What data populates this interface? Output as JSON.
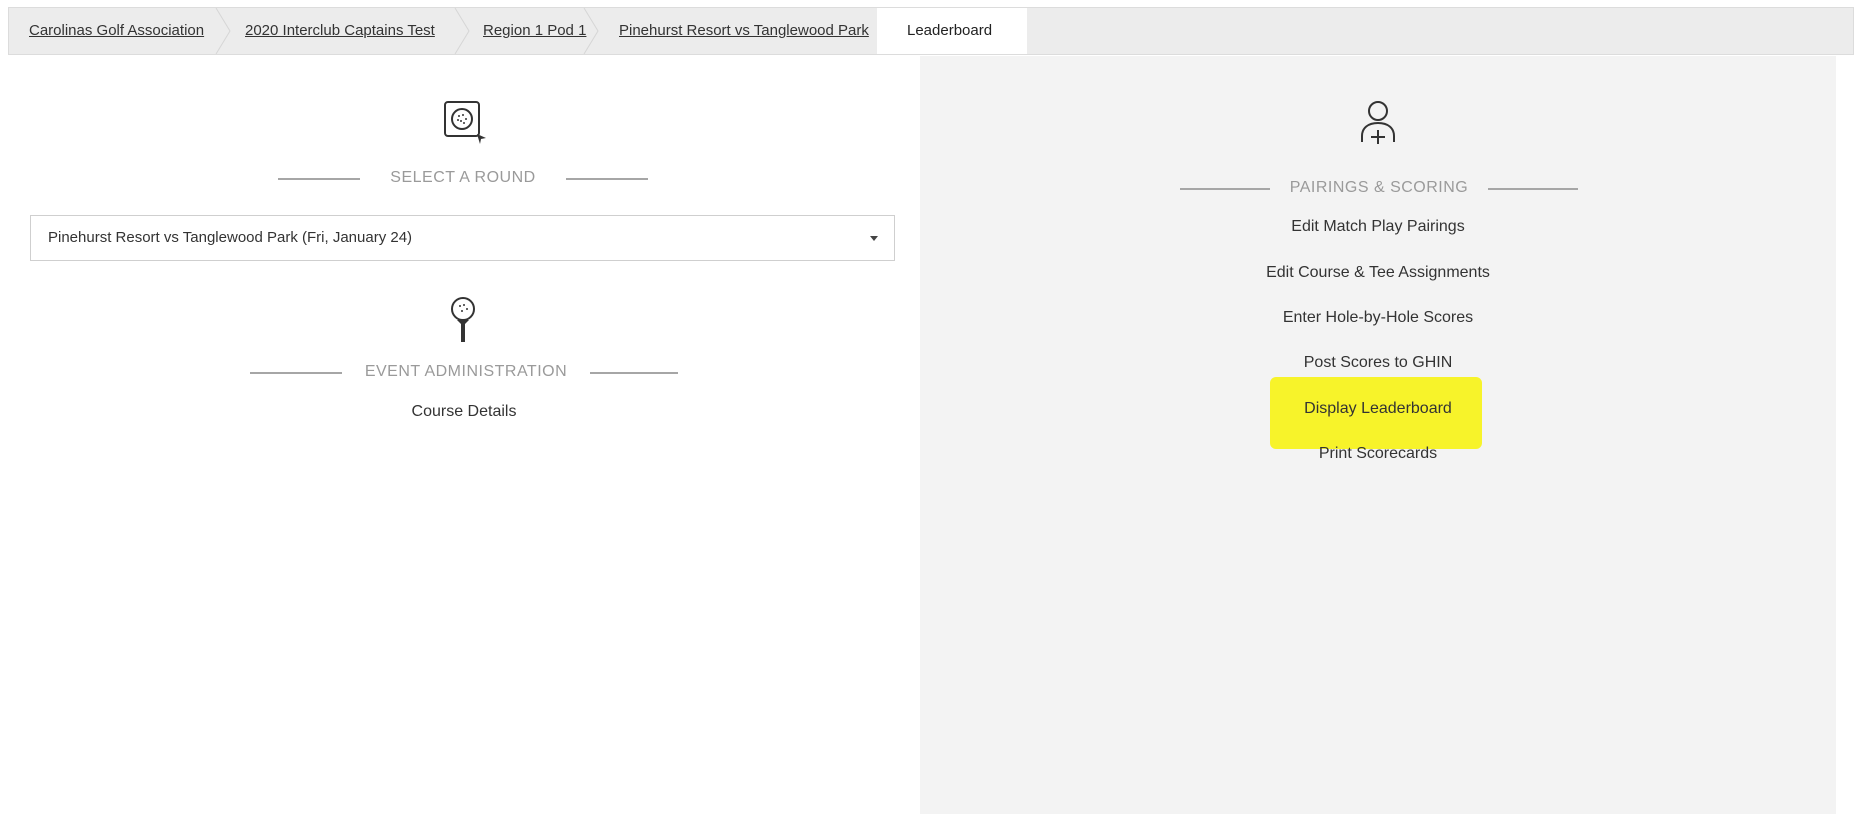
{
  "breadcrumb": {
    "items": [
      {
        "label": "Carolinas Golf Association"
      },
      {
        "label": "2020 Interclub Captains Test"
      },
      {
        "label": "Region 1 Pod 1"
      },
      {
        "label": "Pinehurst Resort vs Tanglewood Park"
      }
    ],
    "active": "Leaderboard"
  },
  "left": {
    "select_round": {
      "icon": "golf-ball-cursor-icon",
      "title": "SELECT A ROUND",
      "selected_value": "Pinehurst Resort vs Tanglewood Park (Fri, January 24)"
    },
    "event_admin": {
      "icon": "golf-ball-tee-icon",
      "title": "EVENT ADMINISTRATION",
      "links": [
        "Course Details"
      ]
    }
  },
  "right": {
    "pairings": {
      "icon": "user-add-icon",
      "title": "PAIRINGS & SCORING",
      "links": [
        "Edit Match Play Pairings",
        "Edit Course & Tee Assignments",
        "Enter Hole-by-Hole Scores",
        "Post Scores to GHIN",
        "Display Leaderboard",
        "Print Scorecards"
      ]
    }
  },
  "colors": {
    "highlight": "#f7f32a",
    "panel_bg": "#f3f3f3",
    "breadcrumb_bg": "#ececec"
  }
}
